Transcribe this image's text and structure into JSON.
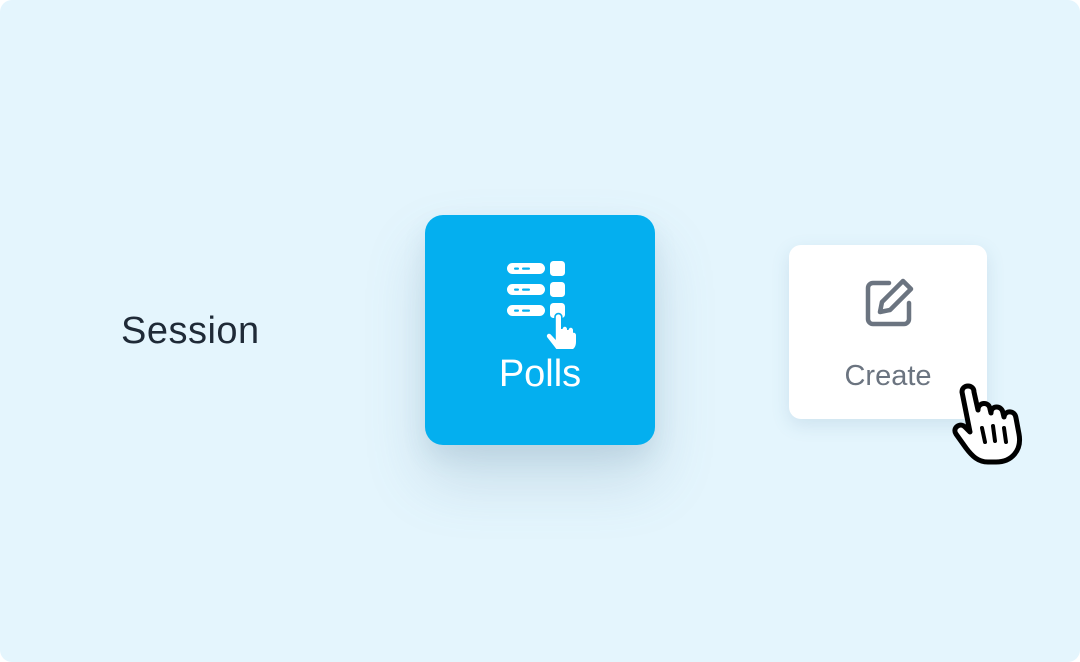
{
  "session": {
    "label": "Session"
  },
  "polls": {
    "label": "Polls",
    "icon": "poll-list-tap-icon",
    "color": "#04afef"
  },
  "create": {
    "label": "Create",
    "icon": "edit-square-icon"
  },
  "cursor": {
    "icon": "hand-pointer-cursor"
  },
  "colors": {
    "background": "#e4f5fd",
    "accent": "#04afef",
    "text_dark": "#1f2a37",
    "text_muted": "#6b7480"
  }
}
